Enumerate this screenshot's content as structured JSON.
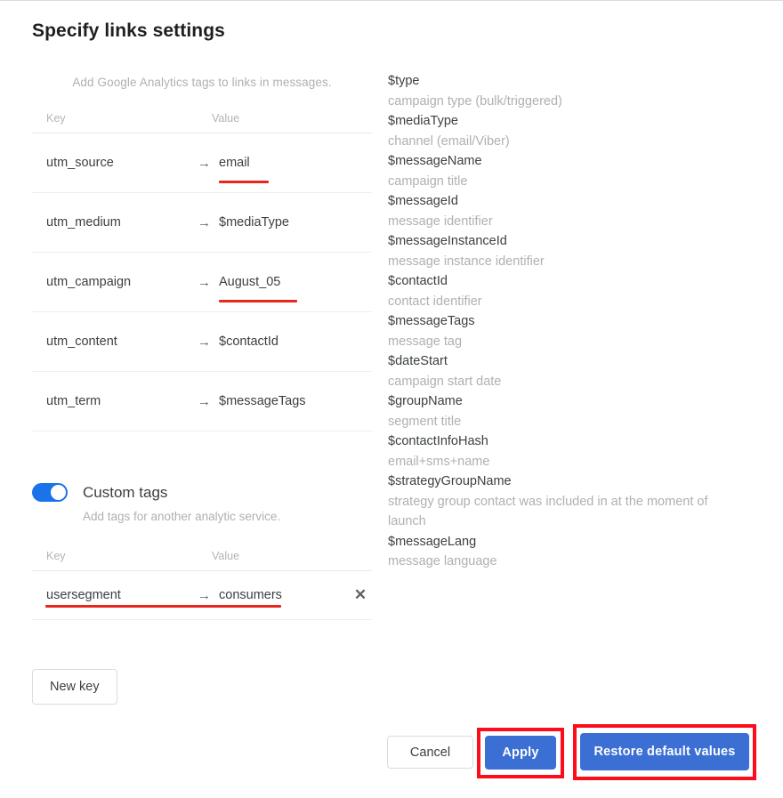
{
  "page_title": "Specify links settings",
  "google_analytics": {
    "hint": "Add Google Analytics tags to links in messages.",
    "columns": {
      "key": "Key",
      "value": "Value"
    },
    "arrow_icon": "→",
    "rows": [
      {
        "key": "utm_source",
        "value": "email",
        "highlighted": true
      },
      {
        "key": "utm_medium",
        "value": "$mediaType",
        "highlighted": false
      },
      {
        "key": "utm_campaign",
        "value": "August_05",
        "highlighted": true
      },
      {
        "key": "utm_content",
        "value": "$contactId",
        "highlighted": false
      },
      {
        "key": "utm_term",
        "value": "$messageTags",
        "highlighted": false
      }
    ]
  },
  "custom_tags": {
    "toggle_label": "Custom tags",
    "toggle_state": "on",
    "hint": "Add tags for another analytic service.",
    "columns": {
      "key": "Key",
      "value": "Value"
    },
    "arrow_icon": "→",
    "delete_icon": "✕",
    "rows": [
      {
        "key": "usersegment",
        "value": "consumers",
        "highlighted": true
      }
    ],
    "new_key_label": "New key"
  },
  "variables": [
    {
      "name": "$type",
      "desc": "campaign type (bulk/triggered)"
    },
    {
      "name": "$mediaType",
      "desc": "channel (email/Viber)"
    },
    {
      "name": "$messageName",
      "desc": "campaign title"
    },
    {
      "name": "$messageId",
      "desc": "message identifier"
    },
    {
      "name": "$messageInstanceId",
      "desc": "message instance identifier"
    },
    {
      "name": "$contactId",
      "desc": "contact identifier"
    },
    {
      "name": "$messageTags",
      "desc": "message tag"
    },
    {
      "name": "$dateStart",
      "desc": "campaign start date"
    },
    {
      "name": "$groupName",
      "desc": "segment title"
    },
    {
      "name": "$contactInfoHash",
      "desc": "email+sms+name"
    },
    {
      "name": "$strategyGroupName",
      "desc": "strategy group contact was included in at the moment of launch"
    },
    {
      "name": "$messageLang",
      "desc": "message language"
    }
  ],
  "footer": {
    "cancel_label": "Cancel",
    "apply_label": "Apply",
    "restore_label": "Restore default values"
  },
  "colors": {
    "primary_blue": "#3b6fd4",
    "toggle_blue": "#1a73e8",
    "highlight_red": "#fc0d1b",
    "underline_red": "#e8261c",
    "text": "#3c4043",
    "muted": "#b0b0b0"
  }
}
